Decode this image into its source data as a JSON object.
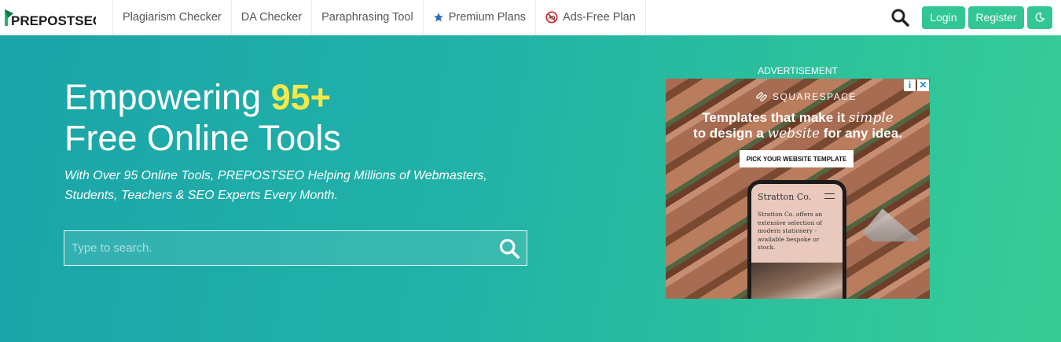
{
  "brand": {
    "logo_text": "PREPOSTSEO"
  },
  "nav": {
    "items": [
      {
        "label": "Plagiarism Checker",
        "icon": ""
      },
      {
        "label": "DA Checker",
        "icon": ""
      },
      {
        "label": "Paraphrasing Tool",
        "icon": ""
      },
      {
        "label": "Premium Plans",
        "icon": "star-icon"
      },
      {
        "label": "Ads-Free Plan",
        "icon": "no-ads-icon"
      }
    ],
    "login_label": "Login",
    "register_label": "Register",
    "dark_mode_icon": "moon-icon",
    "search_icon": "search-icon"
  },
  "hero": {
    "title_prefix": "Empowering ",
    "title_accent": "95+",
    "title_line2": "Free Online Tools",
    "subtitle": "With Over 95 Online Tools, PREPOSTSEO Helping Millions of Webmasters, Students, Teachers & SEO Experts Every Month.",
    "search_placeholder": "Type to search."
  },
  "ad": {
    "label": "ADVERTISEMENT",
    "brand": "SQUARESPACE",
    "headline_part1": "Templates that make it ",
    "headline_script1": "simple",
    "headline_part2": "to design a ",
    "headline_script2": "website",
    "headline_part3": " for any idea.",
    "cta": "PICK YOUR WEBSITE TEMPLATE",
    "phone_title": "Stratton Co.",
    "phone_text": "Stratton Co. offers an extensive selection of modern stationery - available bespoke or stock.",
    "info_icon": "info-icon",
    "close_icon": "close-icon"
  },
  "colors": {
    "accent_green": "#33c695",
    "title_accent": "#f5e94a",
    "hero_start": "#1aa5a9",
    "hero_end": "#37cc96",
    "star_blue": "#2b6cb8",
    "no_ads_red": "#d2232a"
  }
}
